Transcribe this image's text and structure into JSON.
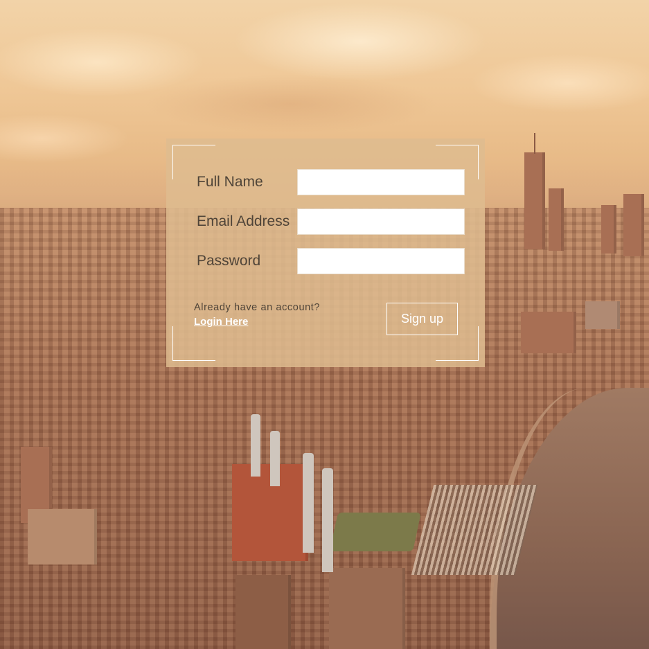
{
  "form": {
    "fields": [
      {
        "label": "Full Name",
        "value": ""
      },
      {
        "label": "Email Address",
        "value": ""
      },
      {
        "label": "Password",
        "value": ""
      }
    ],
    "account_prompt": "Already have an account?",
    "login_link": "Login Here",
    "submit_label": "Sign up"
  },
  "colors": {
    "panel_bg": "#DEBC8F",
    "label_text": "#4F4438",
    "accent_white": "#FFFFFF"
  }
}
